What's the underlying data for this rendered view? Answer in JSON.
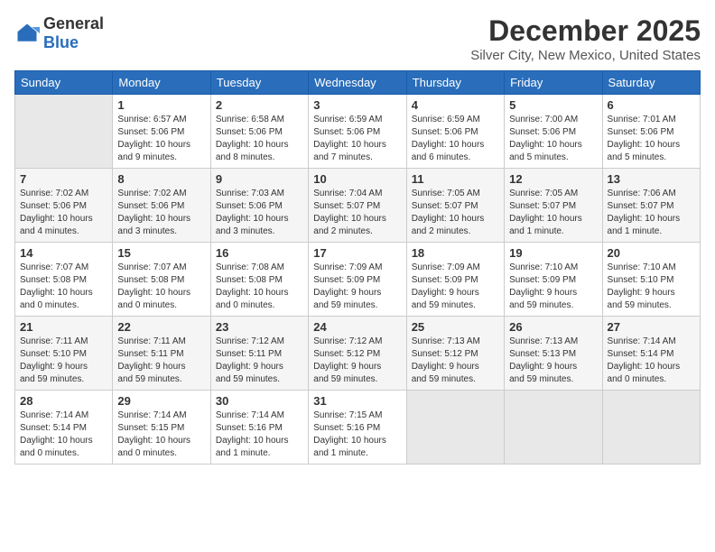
{
  "header": {
    "logo_general": "General",
    "logo_blue": "Blue",
    "title": "December 2025",
    "subtitle": "Silver City, New Mexico, United States"
  },
  "calendar": {
    "days_of_week": [
      "Sunday",
      "Monday",
      "Tuesday",
      "Wednesday",
      "Thursday",
      "Friday",
      "Saturday"
    ],
    "weeks": [
      [
        {
          "day": "",
          "info": ""
        },
        {
          "day": "1",
          "info": "Sunrise: 6:57 AM\nSunset: 5:06 PM\nDaylight: 10 hours\nand 9 minutes."
        },
        {
          "day": "2",
          "info": "Sunrise: 6:58 AM\nSunset: 5:06 PM\nDaylight: 10 hours\nand 8 minutes."
        },
        {
          "day": "3",
          "info": "Sunrise: 6:59 AM\nSunset: 5:06 PM\nDaylight: 10 hours\nand 7 minutes."
        },
        {
          "day": "4",
          "info": "Sunrise: 6:59 AM\nSunset: 5:06 PM\nDaylight: 10 hours\nand 6 minutes."
        },
        {
          "day": "5",
          "info": "Sunrise: 7:00 AM\nSunset: 5:06 PM\nDaylight: 10 hours\nand 5 minutes."
        },
        {
          "day": "6",
          "info": "Sunrise: 7:01 AM\nSunset: 5:06 PM\nDaylight: 10 hours\nand 5 minutes."
        }
      ],
      [
        {
          "day": "7",
          "info": "Sunrise: 7:02 AM\nSunset: 5:06 PM\nDaylight: 10 hours\nand 4 minutes."
        },
        {
          "day": "8",
          "info": "Sunrise: 7:02 AM\nSunset: 5:06 PM\nDaylight: 10 hours\nand 3 minutes."
        },
        {
          "day": "9",
          "info": "Sunrise: 7:03 AM\nSunset: 5:06 PM\nDaylight: 10 hours\nand 3 minutes."
        },
        {
          "day": "10",
          "info": "Sunrise: 7:04 AM\nSunset: 5:07 PM\nDaylight: 10 hours\nand 2 minutes."
        },
        {
          "day": "11",
          "info": "Sunrise: 7:05 AM\nSunset: 5:07 PM\nDaylight: 10 hours\nand 2 minutes."
        },
        {
          "day": "12",
          "info": "Sunrise: 7:05 AM\nSunset: 5:07 PM\nDaylight: 10 hours\nand 1 minute."
        },
        {
          "day": "13",
          "info": "Sunrise: 7:06 AM\nSunset: 5:07 PM\nDaylight: 10 hours\nand 1 minute."
        }
      ],
      [
        {
          "day": "14",
          "info": "Sunrise: 7:07 AM\nSunset: 5:08 PM\nDaylight: 10 hours\nand 0 minutes."
        },
        {
          "day": "15",
          "info": "Sunrise: 7:07 AM\nSunset: 5:08 PM\nDaylight: 10 hours\nand 0 minutes."
        },
        {
          "day": "16",
          "info": "Sunrise: 7:08 AM\nSunset: 5:08 PM\nDaylight: 10 hours\nand 0 minutes."
        },
        {
          "day": "17",
          "info": "Sunrise: 7:09 AM\nSunset: 5:09 PM\nDaylight: 9 hours\nand 59 minutes."
        },
        {
          "day": "18",
          "info": "Sunrise: 7:09 AM\nSunset: 5:09 PM\nDaylight: 9 hours\nand 59 minutes."
        },
        {
          "day": "19",
          "info": "Sunrise: 7:10 AM\nSunset: 5:09 PM\nDaylight: 9 hours\nand 59 minutes."
        },
        {
          "day": "20",
          "info": "Sunrise: 7:10 AM\nSunset: 5:10 PM\nDaylight: 9 hours\nand 59 minutes."
        }
      ],
      [
        {
          "day": "21",
          "info": "Sunrise: 7:11 AM\nSunset: 5:10 PM\nDaylight: 9 hours\nand 59 minutes."
        },
        {
          "day": "22",
          "info": "Sunrise: 7:11 AM\nSunset: 5:11 PM\nDaylight: 9 hours\nand 59 minutes."
        },
        {
          "day": "23",
          "info": "Sunrise: 7:12 AM\nSunset: 5:11 PM\nDaylight: 9 hours\nand 59 minutes."
        },
        {
          "day": "24",
          "info": "Sunrise: 7:12 AM\nSunset: 5:12 PM\nDaylight: 9 hours\nand 59 minutes."
        },
        {
          "day": "25",
          "info": "Sunrise: 7:13 AM\nSunset: 5:12 PM\nDaylight: 9 hours\nand 59 minutes."
        },
        {
          "day": "26",
          "info": "Sunrise: 7:13 AM\nSunset: 5:13 PM\nDaylight: 9 hours\nand 59 minutes."
        },
        {
          "day": "27",
          "info": "Sunrise: 7:14 AM\nSunset: 5:14 PM\nDaylight: 10 hours\nand 0 minutes."
        }
      ],
      [
        {
          "day": "28",
          "info": "Sunrise: 7:14 AM\nSunset: 5:14 PM\nDaylight: 10 hours\nand 0 minutes."
        },
        {
          "day": "29",
          "info": "Sunrise: 7:14 AM\nSunset: 5:15 PM\nDaylight: 10 hours\nand 0 minutes."
        },
        {
          "day": "30",
          "info": "Sunrise: 7:14 AM\nSunset: 5:16 PM\nDaylight: 10 hours\nand 1 minute."
        },
        {
          "day": "31",
          "info": "Sunrise: 7:15 AM\nSunset: 5:16 PM\nDaylight: 10 hours\nand 1 minute."
        },
        {
          "day": "",
          "info": ""
        },
        {
          "day": "",
          "info": ""
        },
        {
          "day": "",
          "info": ""
        }
      ]
    ]
  }
}
